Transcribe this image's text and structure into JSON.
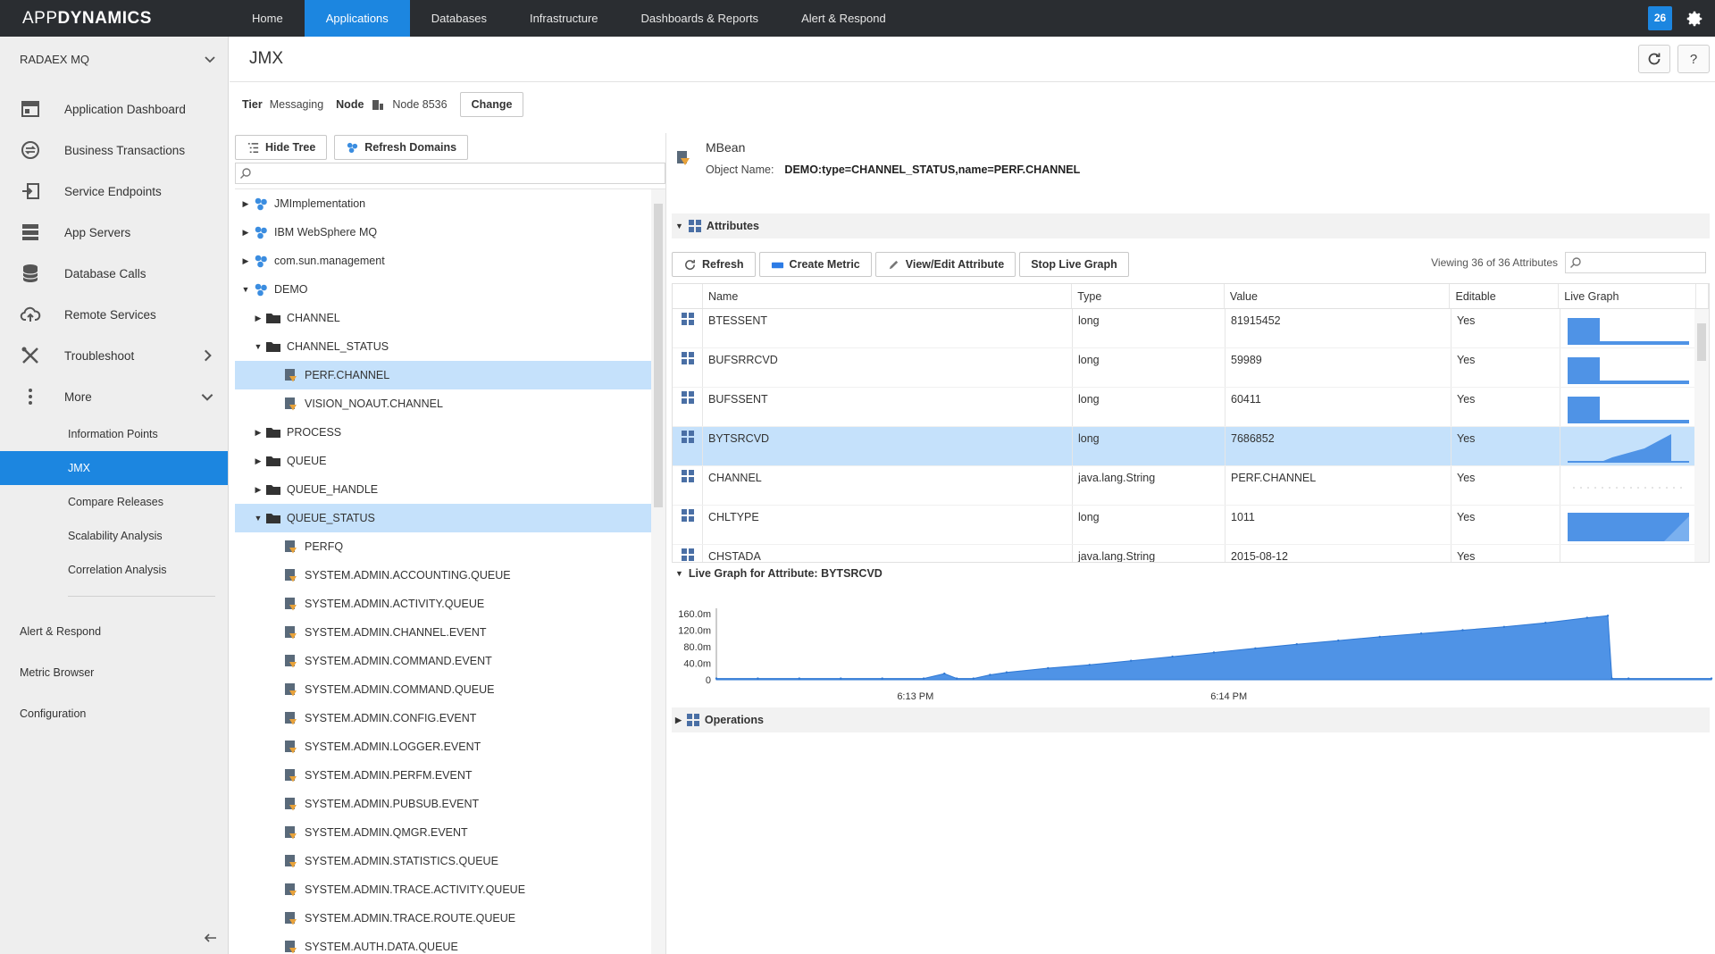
{
  "topnav": {
    "logo_app": "APP",
    "logo_dynamics": "DYNAMICS",
    "items": [
      "Home",
      "Applications",
      "Databases",
      "Infrastructure",
      "Dashboards & Reports",
      "Alert & Respond"
    ],
    "active": "Applications",
    "notification_count": "26"
  },
  "sidebar": {
    "app_name": "RADAEX MQ",
    "items": [
      {
        "label": "Application Dashboard",
        "icon": "dashboard-icon"
      },
      {
        "label": "Business Transactions",
        "icon": "transactions-icon"
      },
      {
        "label": "Service Endpoints",
        "icon": "endpoint-icon"
      },
      {
        "label": "App Servers",
        "icon": "servers-icon"
      },
      {
        "label": "Database Calls",
        "icon": "database-icon"
      },
      {
        "label": "Remote Services",
        "icon": "cloud-upload-icon"
      },
      {
        "label": "Troubleshoot",
        "icon": "tools-icon"
      },
      {
        "label": "More",
        "icon": "more-vertical-icon"
      }
    ],
    "sub_items": [
      "Information Points",
      "JMX",
      "Compare Releases",
      "Scalability Analysis",
      "Correlation Analysis"
    ],
    "active_sub": "JMX",
    "bottom_items": [
      "Alert & Respond",
      "Metric Browser",
      "Configuration"
    ]
  },
  "page": {
    "title": "JMX",
    "tier_label": "Tier",
    "tier_value": "Messaging",
    "node_label": "Node",
    "node_value": "Node 8536",
    "change_button": "Change",
    "hide_tree_button": "Hide Tree",
    "refresh_domains_button": "Refresh Domains"
  },
  "tree": [
    {
      "label": "JMImplementation",
      "level": 0,
      "expand": "collapsed",
      "icon": "domain"
    },
    {
      "label": "IBM WebSphere MQ",
      "level": 0,
      "expand": "collapsed",
      "icon": "domain"
    },
    {
      "label": "com.sun.management",
      "level": 0,
      "expand": "collapsed",
      "icon": "domain"
    },
    {
      "label": "DEMO",
      "level": 0,
      "expand": "expanded",
      "icon": "domain"
    },
    {
      "label": "CHANNEL",
      "level": 1,
      "expand": "collapsed",
      "icon": "folder"
    },
    {
      "label": "CHANNEL_STATUS",
      "level": 1,
      "expand": "expanded",
      "icon": "folder"
    },
    {
      "label": "PERF.CHANNEL",
      "level": 2,
      "expand": "none",
      "icon": "mbean",
      "selected": true
    },
    {
      "label": "VISION_NOAUT.CHANNEL",
      "level": 2,
      "expand": "none",
      "icon": "mbean"
    },
    {
      "label": "PROCESS",
      "level": 1,
      "expand": "collapsed",
      "icon": "folder"
    },
    {
      "label": "QUEUE",
      "level": 1,
      "expand": "collapsed",
      "icon": "folder"
    },
    {
      "label": "QUEUE_HANDLE",
      "level": 1,
      "expand": "collapsed",
      "icon": "folder"
    },
    {
      "label": "QUEUE_STATUS",
      "level": 1,
      "expand": "expanded",
      "icon": "folder",
      "selected": true
    },
    {
      "label": "PERFQ",
      "level": 2,
      "expand": "none",
      "icon": "mbean"
    },
    {
      "label": "SYSTEM.ADMIN.ACCOUNTING.QUEUE",
      "level": 2,
      "expand": "none",
      "icon": "mbean"
    },
    {
      "label": "SYSTEM.ADMIN.ACTIVITY.QUEUE",
      "level": 2,
      "expand": "none",
      "icon": "mbean"
    },
    {
      "label": "SYSTEM.ADMIN.CHANNEL.EVENT",
      "level": 2,
      "expand": "none",
      "icon": "mbean"
    },
    {
      "label": "SYSTEM.ADMIN.COMMAND.EVENT",
      "level": 2,
      "expand": "none",
      "icon": "mbean"
    },
    {
      "label": "SYSTEM.ADMIN.COMMAND.QUEUE",
      "level": 2,
      "expand": "none",
      "icon": "mbean"
    },
    {
      "label": "SYSTEM.ADMIN.CONFIG.EVENT",
      "level": 2,
      "expand": "none",
      "icon": "mbean"
    },
    {
      "label": "SYSTEM.ADMIN.LOGGER.EVENT",
      "level": 2,
      "expand": "none",
      "icon": "mbean"
    },
    {
      "label": "SYSTEM.ADMIN.PERFM.EVENT",
      "level": 2,
      "expand": "none",
      "icon": "mbean"
    },
    {
      "label": "SYSTEM.ADMIN.PUBSUB.EVENT",
      "level": 2,
      "expand": "none",
      "icon": "mbean"
    },
    {
      "label": "SYSTEM.ADMIN.QMGR.EVENT",
      "level": 2,
      "expand": "none",
      "icon": "mbean"
    },
    {
      "label": "SYSTEM.ADMIN.STATISTICS.QUEUE",
      "level": 2,
      "expand": "none",
      "icon": "mbean"
    },
    {
      "label": "SYSTEM.ADMIN.TRACE.ACTIVITY.QUEUE",
      "level": 2,
      "expand": "none",
      "icon": "mbean"
    },
    {
      "label": "SYSTEM.ADMIN.TRACE.ROUTE.QUEUE",
      "level": 2,
      "expand": "none",
      "icon": "mbean"
    },
    {
      "label": "SYSTEM.AUTH.DATA.QUEUE",
      "level": 2,
      "expand": "none",
      "icon": "mbean"
    }
  ],
  "mbean": {
    "title": "MBean",
    "object_name_label": "Object Name:",
    "object_name": "DEMO:type=CHANNEL_STATUS,name=PERF.CHANNEL",
    "attributes_section": "Attributes",
    "operations_section": "Operations",
    "buttons": {
      "refresh": "Refresh",
      "create_metric": "Create Metric",
      "view_edit": "View/Edit Attribute",
      "stop_live_graph": "Stop Live Graph"
    },
    "viewing_text": "Viewing 36 of 36 Attributes",
    "columns": [
      "Name",
      "Type",
      "Value",
      "Editable",
      "Live Graph"
    ],
    "rows": [
      {
        "name": "BTESSENT",
        "type": "long",
        "value": "81915452",
        "editable": "Yes",
        "spark": "step-high"
      },
      {
        "name": "BUFSRRCVD",
        "type": "long",
        "value": "59989",
        "editable": "Yes",
        "spark": "step-high"
      },
      {
        "name": "BUFSSENT",
        "type": "long",
        "value": "60411",
        "editable": "Yes",
        "spark": "step-high"
      },
      {
        "name": "BYTSRCVD",
        "type": "long",
        "value": "7686852",
        "editable": "Yes",
        "spark": "ramp",
        "selected": true
      },
      {
        "name": "CHANNEL",
        "type": "java.lang.String",
        "value": "PERF.CHANNEL",
        "editable": "Yes",
        "spark": "none"
      },
      {
        "name": "CHLTYPE",
        "type": "long",
        "value": "1011",
        "editable": "Yes",
        "spark": "flat-full"
      },
      {
        "name": "CHSTADA",
        "type": "java.lang.String",
        "value": "2015-08-12",
        "editable": "Yes",
        "spark": "none"
      }
    ]
  },
  "chart_data": {
    "type": "area",
    "title": "Live Graph for Attribute: BYTSRCVD",
    "yticks": [
      "160.0m",
      "120.0m",
      "80.0m",
      "40.0m",
      "0"
    ],
    "ylim": [
      0,
      160
    ],
    "xticks": [
      "6:13 PM",
      "6:14 PM"
    ],
    "color": "#4f93e6",
    "x": [
      0,
      10,
      20,
      30,
      40,
      50,
      55,
      58,
      62,
      66,
      70,
      80,
      90,
      100,
      110,
      120,
      130,
      140,
      150,
      160,
      170,
      180,
      190,
      200,
      210,
      215,
      216,
      220,
      240
    ],
    "values": [
      3,
      3,
      3,
      3,
      3,
      3,
      15,
      3,
      3,
      12,
      18,
      28,
      36,
      46,
      56,
      66,
      76,
      86,
      95,
      104,
      112,
      120,
      128,
      138,
      150,
      155,
      3,
      3,
      3
    ]
  }
}
